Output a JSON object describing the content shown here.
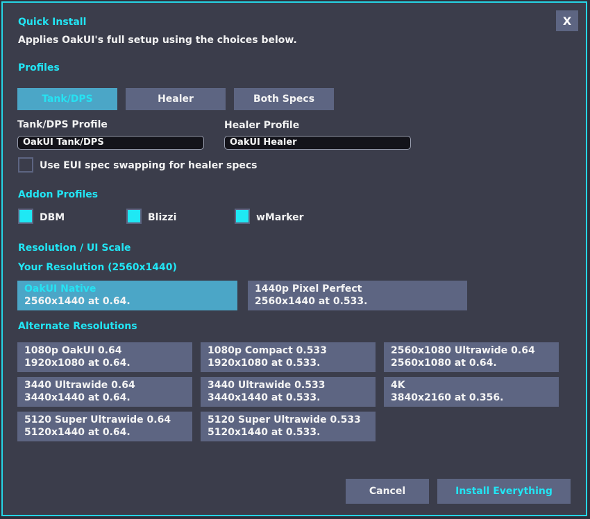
{
  "title": "Quick Install",
  "description": "Applies OakUI's full setup using the choices below.",
  "close_label": "X",
  "profiles": {
    "heading": "Profiles",
    "spec_buttons": [
      "Tank/DPS",
      "Healer",
      "Both Specs"
    ],
    "active_spec": "Tank/DPS",
    "tank_label": "Tank/DPS Profile",
    "tank_value": "OakUI Tank/DPS",
    "healer_label": "Healer Profile",
    "healer_value": "OakUI Healer",
    "swap_label": "Use EUI spec swapping for healer specs",
    "swap_checked": false
  },
  "addons": {
    "heading": "Addon Profiles",
    "items": [
      {
        "label": "DBM",
        "checked": true
      },
      {
        "label": "Blizzi",
        "checked": true
      },
      {
        "label": "wMarker",
        "checked": true
      }
    ]
  },
  "resolution": {
    "heading": "Resolution / UI Scale",
    "your_resolution": "Your Resolution (2560x1440)",
    "native": [
      {
        "title": "OakUI Native",
        "detail": "2560x1440 at 0.64.",
        "active": true
      },
      {
        "title": "1440p Pixel Perfect",
        "detail": "2560x1440 at 0.533.",
        "active": false
      }
    ],
    "alternate_heading": "Alternate Resolutions",
    "alternates": [
      {
        "title": "1080p OakUI 0.64",
        "detail": "1920x1080 at 0.64."
      },
      {
        "title": "1080p Compact 0.533",
        "detail": "1920x1080 at 0.533."
      },
      {
        "title": "2560x1080 Ultrawide 0.64",
        "detail": "2560x1080 at 0.64."
      },
      {
        "title": "3440 Ultrawide 0.64",
        "detail": "3440x1440 at 0.64."
      },
      {
        "title": "3440 Ultrawide 0.533",
        "detail": "3440x1440 at 0.533."
      },
      {
        "title": "4K",
        "detail": "3840x2160 at 0.356."
      },
      {
        "title": "5120 Super Ultrawide 0.64",
        "detail": "5120x1440 at 0.64."
      },
      {
        "title": "5120 Super Ultrawide 0.533",
        "detail": "5120x1440 at 0.533."
      }
    ]
  },
  "footer": {
    "cancel_label": "Cancel",
    "install_label": "Install Everything"
  },
  "colors": {
    "accent": "#22e5f4",
    "panel": "#3b3d4b",
    "button": "#5d6582",
    "active_button": "#4ba6c7"
  }
}
